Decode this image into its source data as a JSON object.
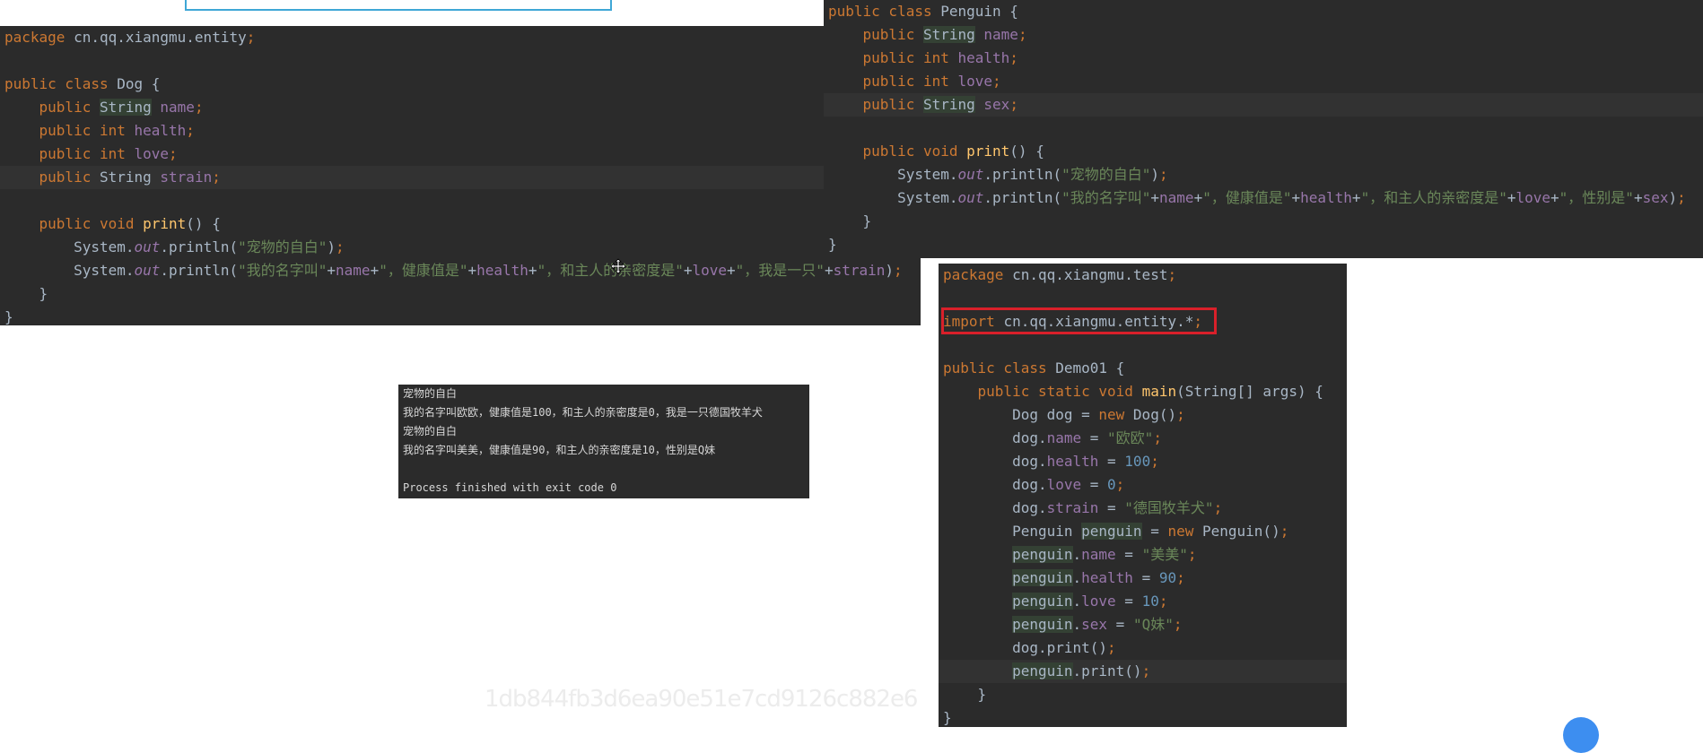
{
  "dog_class": {
    "lines": [
      [
        [
          "kw",
          "package "
        ],
        [
          "plain",
          "cn.qq.xiangmu.entity"
        ],
        [
          "kw",
          ";"
        ]
      ],
      [],
      [
        [
          "kw",
          "public class "
        ],
        [
          "plain",
          "Dog {"
        ]
      ],
      [
        [
          "plain",
          "    "
        ],
        [
          "kw",
          "public "
        ],
        [
          "hlbg",
          "String"
        ],
        [
          "plain",
          " "
        ],
        [
          "fld",
          "name"
        ],
        [
          "kw",
          ";"
        ]
      ],
      [
        [
          "plain",
          "    "
        ],
        [
          "kw",
          "public int "
        ],
        [
          "fld",
          "health"
        ],
        [
          "kw",
          ";"
        ]
      ],
      [
        [
          "plain",
          "    "
        ],
        [
          "kw",
          "public int "
        ],
        [
          "fld",
          "love"
        ],
        [
          "kw",
          ";"
        ]
      ],
      [
        [
          "plain",
          "    "
        ],
        [
          "kw",
          "public "
        ],
        [
          "plain",
          "String "
        ],
        [
          "fld",
          "strain"
        ],
        [
          "kw",
          ";"
        ]
      ],
      [],
      [
        [
          "plain",
          "    "
        ],
        [
          "kw",
          "public void "
        ],
        [
          "fn",
          "print"
        ],
        [
          "plain",
          "() {"
        ]
      ],
      [
        [
          "plain",
          "        System."
        ],
        [
          "it",
          "out"
        ],
        [
          "plain",
          ".println("
        ],
        [
          "str",
          "\"宠物的自白\""
        ],
        [
          "plain",
          ")"
        ],
        [
          "kw",
          ";"
        ]
      ],
      [
        [
          "plain",
          "        System."
        ],
        [
          "it",
          "out"
        ],
        [
          "plain",
          ".println("
        ],
        [
          "str",
          "\"我的名字叫\""
        ],
        [
          "plain",
          "+"
        ],
        [
          "fld",
          "name"
        ],
        [
          "plain",
          "+"
        ],
        [
          "str",
          "\"，健康值是\""
        ],
        [
          "plain",
          "+"
        ],
        [
          "fld",
          "health"
        ],
        [
          "plain",
          "+"
        ],
        [
          "str",
          "\"，和主人的亲密度是\""
        ],
        [
          "plain",
          "+"
        ],
        [
          "fld",
          "love"
        ],
        [
          "plain",
          "+"
        ],
        [
          "str",
          "\"，我是一只\""
        ],
        [
          "plain",
          "+"
        ],
        [
          "fld",
          "strain"
        ],
        [
          "plain",
          ")"
        ],
        [
          "kw",
          ";"
        ]
      ],
      [
        [
          "plain",
          "    }"
        ]
      ],
      [
        [
          "plain",
          "}"
        ]
      ]
    ]
  },
  "penguin_class": {
    "lines": [
      [
        [
          "kw",
          "public class "
        ],
        [
          "plain",
          "Penguin {"
        ]
      ],
      [
        [
          "plain",
          "    "
        ],
        [
          "kw",
          "public "
        ],
        [
          "hlbg",
          "String"
        ],
        [
          "plain",
          " "
        ],
        [
          "fld",
          "name"
        ],
        [
          "kw",
          ";"
        ]
      ],
      [
        [
          "plain",
          "    "
        ],
        [
          "kw",
          "public int "
        ],
        [
          "fld",
          "health"
        ],
        [
          "kw",
          ";"
        ]
      ],
      [
        [
          "plain",
          "    "
        ],
        [
          "kw",
          "public int "
        ],
        [
          "fld",
          "love"
        ],
        [
          "kw",
          ";"
        ]
      ],
      [
        [
          "plain",
          "    "
        ],
        [
          "kw",
          "public "
        ],
        [
          "hlbg",
          "String"
        ],
        [
          "plain",
          " "
        ],
        [
          "fld",
          "sex"
        ],
        [
          "kw",
          ";"
        ]
      ],
      [],
      [
        [
          "plain",
          "    "
        ],
        [
          "kw",
          "public void "
        ],
        [
          "fn",
          "print"
        ],
        [
          "plain",
          "() {"
        ]
      ],
      [
        [
          "plain",
          "        System."
        ],
        [
          "it",
          "out"
        ],
        [
          "plain",
          ".println("
        ],
        [
          "str",
          "\"宠物的自白\""
        ],
        [
          "plain",
          ")"
        ],
        [
          "kw",
          ";"
        ]
      ],
      [
        [
          "plain",
          "        System."
        ],
        [
          "it",
          "out"
        ],
        [
          "plain",
          ".println("
        ],
        [
          "str",
          "\"我的名字叫\""
        ],
        [
          "plain",
          "+"
        ],
        [
          "fld",
          "name"
        ],
        [
          "plain",
          "+"
        ],
        [
          "str",
          "\"，健康值是\""
        ],
        [
          "plain",
          "+"
        ],
        [
          "fld",
          "health"
        ],
        [
          "plain",
          "+"
        ],
        [
          "str",
          "\"，和主人的亲密度是\""
        ],
        [
          "plain",
          "+"
        ],
        [
          "fld",
          "love"
        ],
        [
          "plain",
          "+"
        ],
        [
          "str",
          "\"，性别是\""
        ],
        [
          "plain",
          "+"
        ],
        [
          "fld",
          "sex"
        ],
        [
          "plain",
          ")"
        ],
        [
          "kw",
          ";"
        ]
      ],
      [
        [
          "plain",
          "    }"
        ]
      ],
      [
        [
          "plain",
          "}"
        ]
      ]
    ]
  },
  "demo_class": {
    "lines": [
      [
        [
          "kw",
          "package "
        ],
        [
          "plain",
          "cn.qq.xiangmu.test"
        ],
        [
          "kw",
          ";"
        ]
      ],
      [],
      [
        [
          "kw",
          "import "
        ],
        [
          "plain",
          "cn.qq.xiangmu.entity.*"
        ],
        [
          "kw",
          ";"
        ]
      ],
      [],
      [
        [
          "kw",
          "public class "
        ],
        [
          "plain",
          "Demo01 {"
        ]
      ],
      [
        [
          "plain",
          "    "
        ],
        [
          "kw",
          "public static void "
        ],
        [
          "fn",
          "main"
        ],
        [
          "plain",
          "(String[] args) {"
        ]
      ],
      [
        [
          "plain",
          "        Dog dog = "
        ],
        [
          "kw",
          "new "
        ],
        [
          "plain",
          "Dog()"
        ],
        [
          "kw",
          ";"
        ]
      ],
      [
        [
          "plain",
          "        dog."
        ],
        [
          "fld",
          "name"
        ],
        [
          "plain",
          " = "
        ],
        [
          "str",
          "\"欧欧\""
        ],
        [
          "kw",
          ";"
        ]
      ],
      [
        [
          "plain",
          "        dog."
        ],
        [
          "fld",
          "health"
        ],
        [
          "plain",
          " = "
        ],
        [
          "num",
          "100"
        ],
        [
          "kw",
          ";"
        ]
      ],
      [
        [
          "plain",
          "        dog."
        ],
        [
          "fld",
          "love"
        ],
        [
          "plain",
          " = "
        ],
        [
          "num",
          "0"
        ],
        [
          "kw",
          ";"
        ]
      ],
      [
        [
          "plain",
          "        dog."
        ],
        [
          "fld",
          "strain"
        ],
        [
          "plain",
          " = "
        ],
        [
          "str",
          "\"德国牧羊犬\""
        ],
        [
          "kw",
          ";"
        ]
      ],
      [
        [
          "plain",
          "        Penguin "
        ],
        [
          "hlbg",
          "penguin"
        ],
        [
          "plain",
          " = "
        ],
        [
          "kw",
          "new "
        ],
        [
          "plain",
          "Penguin()"
        ],
        [
          "kw",
          ";"
        ]
      ],
      [
        [
          "plain",
          "        "
        ],
        [
          "hlbg",
          "penguin"
        ],
        [
          "plain",
          "."
        ],
        [
          "fld",
          "name"
        ],
        [
          "plain",
          " = "
        ],
        [
          "str",
          "\"美美\""
        ],
        [
          "kw",
          ";"
        ]
      ],
      [
        [
          "plain",
          "        "
        ],
        [
          "hlbg",
          "penguin"
        ],
        [
          "plain",
          "."
        ],
        [
          "fld",
          "health"
        ],
        [
          "plain",
          " = "
        ],
        [
          "num",
          "90"
        ],
        [
          "kw",
          ";"
        ]
      ],
      [
        [
          "plain",
          "        "
        ],
        [
          "hlbg",
          "penguin"
        ],
        [
          "plain",
          "."
        ],
        [
          "fld",
          "love"
        ],
        [
          "plain",
          " = "
        ],
        [
          "num",
          "10"
        ],
        [
          "kw",
          ";"
        ]
      ],
      [
        [
          "plain",
          "        "
        ],
        [
          "hlbg",
          "penguin"
        ],
        [
          "plain",
          "."
        ],
        [
          "fld",
          "sex"
        ],
        [
          "plain",
          " = "
        ],
        [
          "str",
          "\"Q妹\""
        ],
        [
          "kw",
          ";"
        ]
      ],
      [
        [
          "plain",
          "        dog.print()"
        ],
        [
          "kw",
          ";"
        ]
      ],
      [
        [
          "plain",
          "        "
        ],
        [
          "hlbg",
          "penguin"
        ],
        [
          "plain",
          ".print()"
        ],
        [
          "kw",
          ";"
        ]
      ],
      [
        [
          "plain",
          "    }"
        ]
      ],
      [
        [
          "plain",
          "}"
        ]
      ]
    ]
  },
  "console": {
    "lines": [
      "宠物的自白",
      "我的名字叫欧欧，健康值是100，和主人的亲密度是0，我是一只德国牧羊犬",
      "宠物的自白",
      "我的名字叫美美，健康值是90，和主人的亲密度是10，性别是Q妹",
      "",
      "Process finished with exit code 0"
    ]
  },
  "watermark": {
    "text": "1db844fb3d6ea90e51e7cd9126c882e6"
  },
  "colors": {
    "editor_bg": "#2b2b2b",
    "keyword": "#cc7832",
    "field": "#9876aa",
    "string": "#6a8759",
    "number": "#6897bb",
    "method": "#ffc66d",
    "import_highlight_border": "#d9202a"
  },
  "icons": {
    "cursor": "move-cursor-icon",
    "fab": "scroll-top-icon"
  }
}
